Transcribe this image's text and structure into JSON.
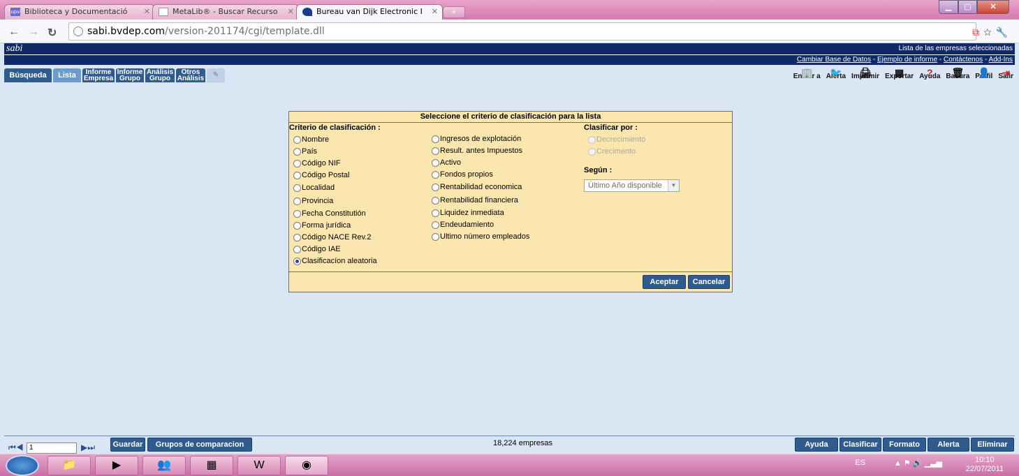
{
  "browser": {
    "tabs": [
      {
        "title": "Biblioteca y Documentació",
        "favicon_text": "upv"
      },
      {
        "title": "MetaLib® - Buscar Recurso"
      },
      {
        "title": "Bureau van Dijk Electronic I"
      }
    ],
    "url_host": "sabi.bvdep.com",
    "url_path": "/version-201174/cgi/template.dll"
  },
  "app": {
    "logo": "sabi",
    "header_right": "Lista de las empresas seleccionadas",
    "links": [
      "Cambiar Base de Datos",
      "Ejemplo de informe",
      "Contáctenos",
      "Add-Ins"
    ],
    "link_separator": " - ",
    "tabs": [
      {
        "label": "Búsqueda"
      },
      {
        "label": "Lista"
      },
      {
        "line1": "Informe",
        "line2": "Empresa"
      },
      {
        "line1": "Informe",
        "line2": "Grupo"
      },
      {
        "line1": "Análisis",
        "line2": "Grupo"
      },
      {
        "line1": "Otros",
        "line2": "Análisis"
      }
    ],
    "actions": [
      "Enviar a",
      "Alerta",
      "Imprimir",
      "Exportar",
      "Ayuda",
      "Basura",
      "Perfil",
      "Salir"
    ]
  },
  "dialog": {
    "title": "Seleccione el criterio de clasificación para la lista",
    "criteria_heading": "Criterio de clasificación :",
    "criteria_col1": [
      "Nombre",
      "País",
      "Código NIF",
      "Código Postal",
      "Localidad",
      "Provincia",
      "Fecha Constitutión",
      "Forma jurídica",
      "Código NACE Rev.2",
      "Código IAE",
      "Clasificacíon aleatoria"
    ],
    "criteria_col2": [
      "Ingresos de explotación",
      "Result. antes Impuestos",
      "Activo",
      "Fondos propios",
      "Rentabilidad economica",
      "Rentabilidad financiera",
      "Liquidez inmediata",
      "Endeudamiento",
      "Ultimo número empleados"
    ],
    "selected": "Clasificacíon aleatoria",
    "sort_heading": "Clasificar por :",
    "sort_options": [
      "Decrecimiento",
      "Crecimento"
    ],
    "segun_heading": "Según :",
    "segun_value": "Último Año disponible",
    "accept": "Aceptar",
    "cancel": "Cancelar"
  },
  "bottom": {
    "page": "1",
    "save": "Guardar",
    "groups": "Grupos de comparacion",
    "count": "18,224 empresas",
    "buttons": [
      "Ayuda",
      "Clasificar",
      "Formato",
      "Alerta",
      "Eliminar"
    ]
  },
  "taskbar": {
    "lang": "ES",
    "time": "10:10",
    "date": "22/07/2011"
  }
}
